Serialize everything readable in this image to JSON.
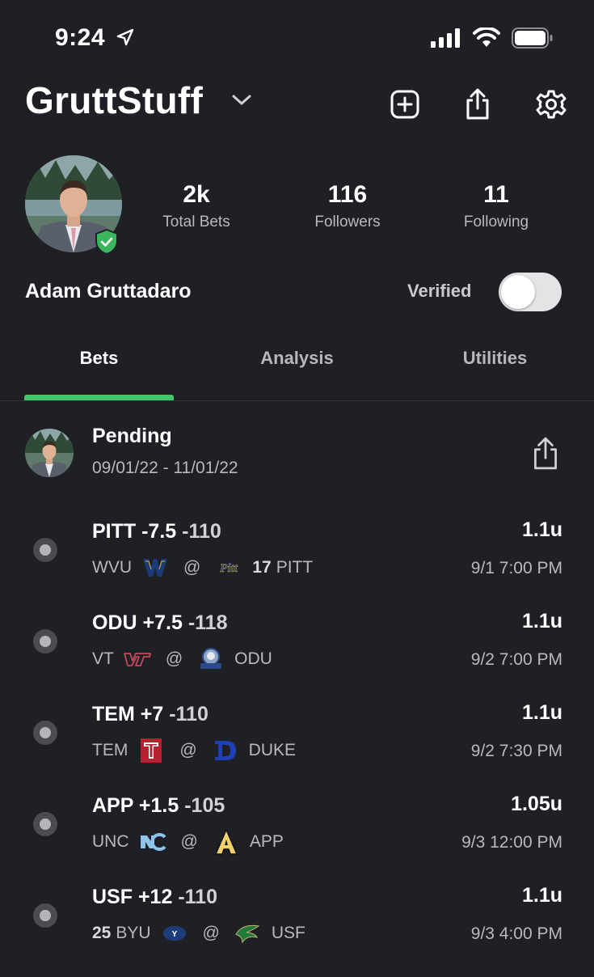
{
  "status_bar": {
    "time": "9:24"
  },
  "header": {
    "username": "GruttStuff"
  },
  "profile": {
    "name": "Adam Gruttadaro",
    "verified_label": "Verified",
    "stats": [
      {
        "value": "2k",
        "label": "Total Bets"
      },
      {
        "value": "116",
        "label": "Followers"
      },
      {
        "value": "11",
        "label": "Following"
      }
    ]
  },
  "tabs": [
    {
      "label": "Bets",
      "active": true
    },
    {
      "label": "Analysis",
      "active": false
    },
    {
      "label": "Utilities",
      "active": false
    }
  ],
  "pending": {
    "title": "Pending",
    "date_range": "09/01/22 - 11/01/22"
  },
  "bets": [
    {
      "pick": "PITT -7.5",
      "odds": "-110",
      "units": "1.1u",
      "away": "WVU",
      "away_rank": "",
      "at": "@",
      "home": "PITT",
      "home_rank": "17",
      "time": "9/1 7:00 PM"
    },
    {
      "pick": "ODU +7.5",
      "odds": "-118",
      "units": "1.1u",
      "away": "VT",
      "away_rank": "",
      "at": "@",
      "home": "ODU",
      "home_rank": "",
      "time": "9/2 7:00 PM"
    },
    {
      "pick": "TEM +7",
      "odds": "-110",
      "units": "1.1u",
      "away": "TEM",
      "away_rank": "",
      "at": "@",
      "home": "DUKE",
      "home_rank": "",
      "time": "9/2 7:30 PM"
    },
    {
      "pick": "APP +1.5",
      "odds": "-105",
      "units": "1.05u",
      "away": "UNC",
      "away_rank": "",
      "at": "@",
      "home": "APP",
      "home_rank": "",
      "time": "9/3 12:00 PM"
    },
    {
      "pick": "USF +12",
      "odds": "-110",
      "units": "1.1u",
      "away": "BYU",
      "away_rank": "25",
      "at": "@",
      "home": "USF",
      "home_rank": "",
      "time": "9/3 4:00 PM"
    }
  ],
  "colors": {
    "background": "#1f2026",
    "accent": "#45c56a",
    "badge": "#3bb55e"
  },
  "team_logos": {
    "wvu": "wvu-logo",
    "pitt": "pitt-logo",
    "vt": "vt-logo",
    "odu": "odu-logo",
    "tem": "temple-logo",
    "duke": "duke-logo",
    "unc": "unc-logo",
    "app": "app-state-logo",
    "byu": "byu-logo",
    "usf": "usf-logo"
  }
}
